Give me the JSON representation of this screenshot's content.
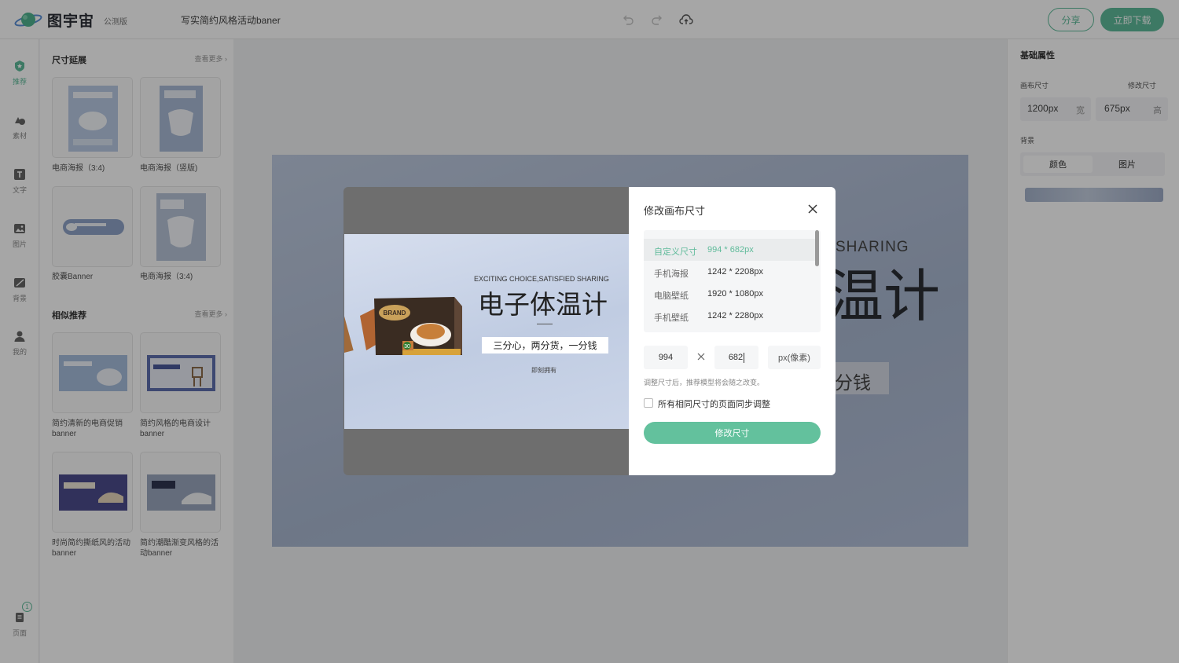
{
  "header": {
    "brand": "图宇宙",
    "beta": "公测版",
    "doc_title": "写实简约风格活动baner",
    "share": "分享",
    "download": "立即下载"
  },
  "rail": [
    {
      "label": "推荐",
      "icon": "recommend-icon",
      "active": true
    },
    {
      "label": "素材",
      "icon": "shapes-icon"
    },
    {
      "label": "文字",
      "icon": "text-icon"
    },
    {
      "label": "图片",
      "icon": "image-icon"
    },
    {
      "label": "背景",
      "icon": "background-icon"
    },
    {
      "label": "我的",
      "icon": "user-icon"
    },
    {
      "label": "页面",
      "icon": "pages-icon",
      "badge": "1"
    }
  ],
  "left_panel": {
    "sections": [
      {
        "title": "尺寸延展",
        "more": "查看更多",
        "items": [
          {
            "caption": "电商海报（3:4)"
          },
          {
            "caption": "电商海报（竖版)"
          },
          {
            "caption": "胶囊Banner"
          },
          {
            "caption": "电商海报（3:4)"
          }
        ]
      },
      {
        "title": "相似推荐",
        "more": "查看更多",
        "items": [
          {
            "caption": "简约清新的电商促销banner"
          },
          {
            "caption": "简约风格的电商设计banner"
          },
          {
            "caption": "时尚简约撕纸风的活动banner"
          },
          {
            "caption": "简约潮酷渐变风格的活动banner"
          }
        ]
      }
    ]
  },
  "canvas": {
    "sharing_text": "SHARING",
    "headline_tail": "温计",
    "tagline_tail": "分钱"
  },
  "right_panel": {
    "title": "基础属性",
    "canvas_size_label": "画布尺寸",
    "resize_link": "修改尺寸",
    "width_value": "1200px",
    "width_unit": "宽",
    "height_value": "675px",
    "height_unit": "高",
    "background_label": "背景",
    "tab_color": "颜色",
    "tab_image": "图片"
  },
  "preview": {
    "tagline_en": "EXCITING CHOICE,SATISFIED SHARING",
    "headline": "电子体温计",
    "tagline_cn": "三分心，两分货，一分钱",
    "cta": "即刻拥有",
    "brand_label": "BRAND",
    "count_label": "30"
  },
  "modal": {
    "title": "修改画布尺寸",
    "presets": [
      {
        "name": "自定义尺寸",
        "size": "994 * 682px",
        "selected": true
      },
      {
        "name": "手机海报",
        "size": "1242 * 2208px"
      },
      {
        "name": "电脑壁纸",
        "size": "1920 * 1080px"
      },
      {
        "name": "手机壁纸",
        "size": "1242 * 2280px"
      }
    ],
    "width_value": "994",
    "height_value": "682",
    "unit_label": "px(像素)",
    "hint": "调整尺寸后，推荐模型将会随之改变。",
    "sync_label": "所有相同尺寸的页面同步调整",
    "submit": "修改尺寸"
  },
  "colors": {
    "accent": "#5fbb9a",
    "overlay": "rgba(0,0,0,0.35)"
  }
}
